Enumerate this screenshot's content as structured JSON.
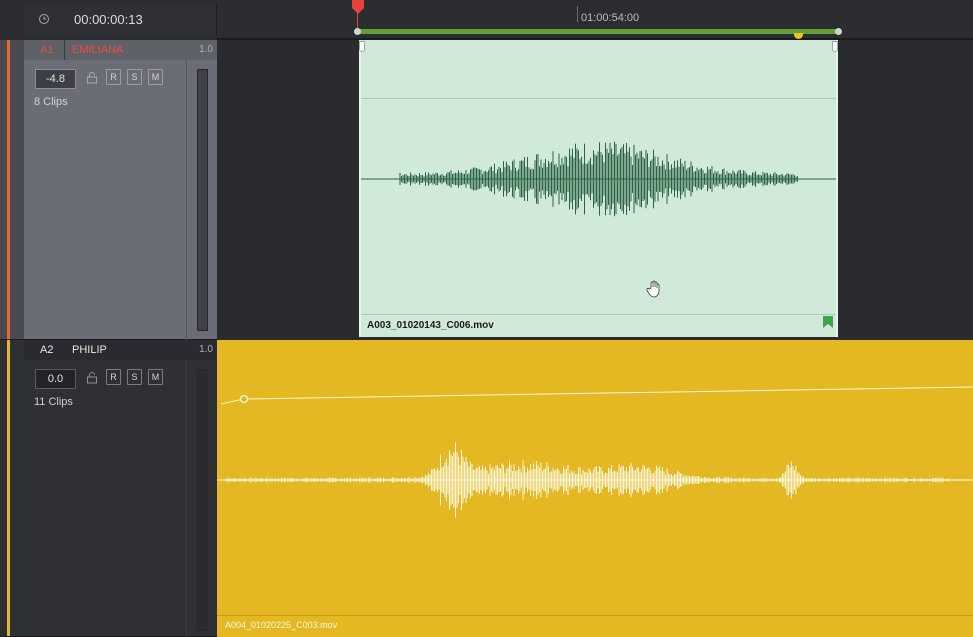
{
  "header": {
    "timecode": "00:00:00:13",
    "ruler_label": "01:00:54:00"
  },
  "tracks": [
    {
      "id": "A1",
      "name": "EMILIANA",
      "level": "1.0",
      "volume": "-4.8",
      "clip_count": "8 Clips",
      "color": "#e66a2c",
      "label_color": "#ef4c43",
      "buttons": [
        "R",
        "S",
        "M"
      ],
      "clip_name": "A003_01020143_C006.mov",
      "clip_color": "#d1e9d8",
      "waveform_color": "#2a6445"
    },
    {
      "id": "A2",
      "name": "PHILIP",
      "level": "1.0",
      "volume": "0.0",
      "clip_count": "11 Clips",
      "color": "#e4b822",
      "label_color": "#e8e8e8",
      "buttons": [
        "R",
        "S",
        "M"
      ],
      "clip_name": "A004_01020225_C003.mov",
      "clip_color": "#e4b822",
      "waveform_color": "#fff6de"
    }
  ],
  "icons": {
    "clock": "clock-icon",
    "lock": "lock-icon",
    "playhead": "playhead-icon",
    "flag": "flag-icon",
    "cursor": "hand-cursor-icon"
  },
  "colors": {
    "range_bar": "#5fa136",
    "playhead": "#e8413c",
    "marker": "#e6c51e"
  }
}
